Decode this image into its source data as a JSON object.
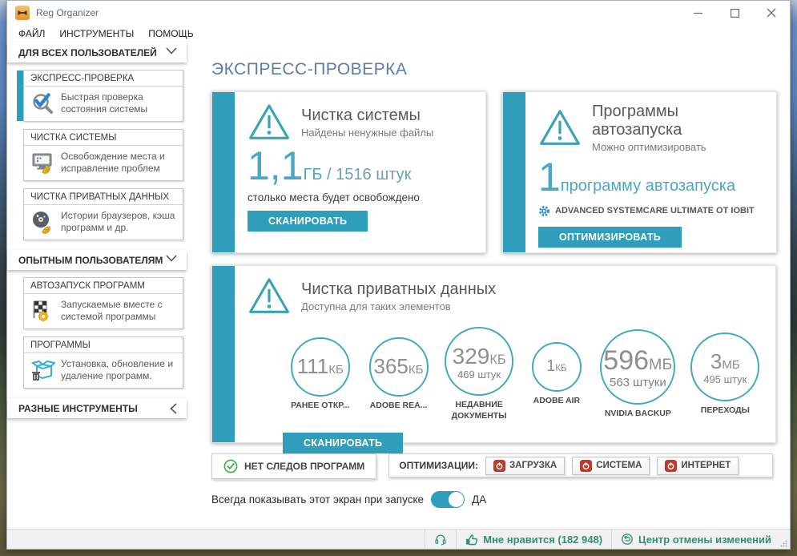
{
  "window": {
    "title": "Reg Organizer"
  },
  "menu": {
    "items": [
      "ФАЙЛ",
      "ИНСТРУМЕНТЫ",
      "ПОМОЩЬ"
    ]
  },
  "sidebar": {
    "groups": [
      {
        "label": "ДЛЯ ВСЕХ ПОЛЬЗОВАТЕЛЕЙ",
        "items": [
          {
            "title": "ЭКСПРЕСС-ПРОВЕРКА",
            "desc": "Быстрая проверка состояния системы",
            "icon": "magnifier-check"
          },
          {
            "title": "ЧИСТКА СИСТЕМЫ",
            "desc": "Освобождение места и исправление проблем",
            "icon": "monitor-brush"
          },
          {
            "title": "ЧИСТКА ПРИВАТНЫХ ДАННЫХ",
            "desc": "Истории браузеров, кэша программ и др.",
            "icon": "disc-brush"
          }
        ]
      },
      {
        "label": "ОПЫТНЫМ ПОЛЬЗОВАТЕЛЯМ",
        "items": [
          {
            "title": "АВТОЗАПУСК ПРОГРАММ",
            "desc": "Запускаемые вместе с системой программы",
            "icon": "flag-gear"
          },
          {
            "title": "ПРОГРАММЫ",
            "desc": "Установка, обновление и удаление программ.",
            "icon": "box-trash"
          }
        ]
      },
      {
        "label": "РАЗНЫЕ ИНСТРУМЕНТЫ",
        "items": []
      }
    ]
  },
  "main": {
    "heading": "ЭКСПРЕСС-ПРОВЕРКА",
    "system": {
      "title": "Чистка системы",
      "subtitle": "Найдены ненужные файлы",
      "value": "1,1",
      "unit": "ГБ",
      "count": " / 1516 штук",
      "note": "столько места будет освобождено",
      "button": "СКАНИРОВАТЬ"
    },
    "autostart": {
      "title": "Программы автозапуска",
      "subtitle": "Можно оптимизировать",
      "value": "1",
      "value_label": "программу автозапуска",
      "entry": "ADVANCED SYSTEMCARE ULTIMATE ОТ IOBIT",
      "button": "ОПТИМИЗИРОВАТЬ"
    },
    "privacy": {
      "title": "Чистка приватных данных",
      "subtitle": "Доступна для таких элементов",
      "button": "СКАНИРОВАТЬ",
      "items": [
        {
          "value": "111",
          "unit": "КБ",
          "count": "",
          "label": "РАНЕЕ ОТКР..."
        },
        {
          "value": "365",
          "unit": "КБ",
          "count": "",
          "label": "ADOBE REA..."
        },
        {
          "value": "329",
          "unit": "КБ",
          "count": "469 штук",
          "label": "НЕДАВНИЕ ДОКУМЕНТЫ"
        },
        {
          "value": "1",
          "unit": "КБ",
          "count": "",
          "label": "ADOBE AIR"
        },
        {
          "value": "596",
          "unit": "МБ",
          "count": "563 штуки",
          "label": "NVIDIA BACKUP"
        },
        {
          "value": "3",
          "unit": "МБ",
          "count": "495 штук",
          "label": "ПЕРЕХОДЫ"
        }
      ]
    },
    "footer": {
      "no_traces": "НЕТ СЛЕДОВ ПРОГРАММ",
      "optimizations_label": "ОПТИМИЗАЦИИ:",
      "optimizations": [
        "ЗАГРУЗКА",
        "СИСТЕМА",
        "ИНТЕРНЕТ"
      ],
      "always_show_label": "Всегда показывать этот экран при запуске",
      "toggle_state": "ДА"
    }
  },
  "statusbar": {
    "like_label": "Мне нравится (182 948)",
    "undo_label": "Центр отмены изменений"
  },
  "colors": {
    "accent_teal": "#2f9eba",
    "heading_blue": "#5b7da9",
    "status_green": "#2e9077",
    "danger_red": "#c0392b"
  }
}
